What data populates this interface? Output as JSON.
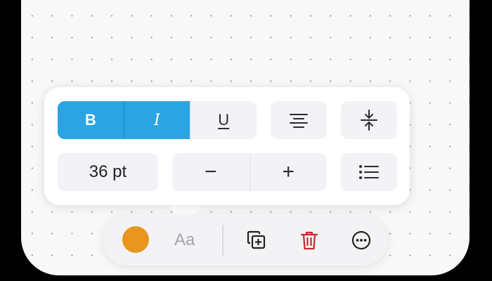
{
  "format_popover": {
    "bold_label": "B",
    "italic_label": "I",
    "underline_label": "U",
    "font_size": "36 pt",
    "decrease_symbol": "−",
    "increase_symbol": "+",
    "active_styles": [
      "bold",
      "italic"
    ],
    "icons": [
      "align-center-icon",
      "vertical-center-icon",
      "list-icon"
    ]
  },
  "toolbar": {
    "color_swatch": "#ea9520",
    "text_style_label": "Aa",
    "icons": [
      "duplicate-icon",
      "trash-icon",
      "more-icon"
    ],
    "trash_color": "#c9272d"
  },
  "colors": {
    "accent": "#2ba4e4",
    "canvas": "#f8f8f8",
    "button_bg": "#f2f2f7"
  }
}
